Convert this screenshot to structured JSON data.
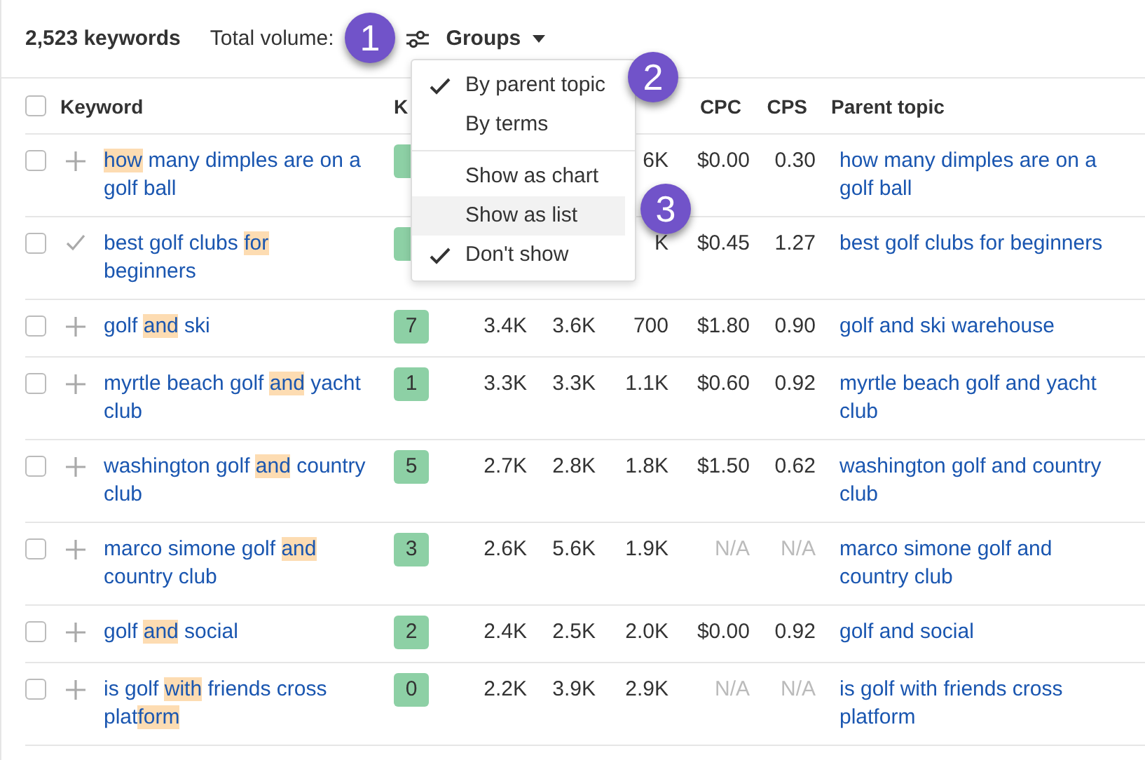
{
  "toolbar": {
    "keyword_count": "2,523 keywords",
    "total_volume_label": "Total volume:",
    "groups_label": "Groups"
  },
  "columns": {
    "select_all_checked": false,
    "keyword": "Keyword",
    "kd": "K",
    "cpc": "CPC",
    "cps": "CPS",
    "parent_topic": "Parent topic"
  },
  "rows": [
    {
      "checked": false,
      "added": false,
      "keyword": [
        {
          "text": "how",
          "highlight": true
        },
        {
          "text": " many dimples are on a golf ball",
          "highlight": false
        }
      ],
      "column_5": "6K",
      "cpc": "$0.00",
      "cps": "0.30",
      "unavailable": false,
      "parent_topic": "how many dimples are on a golf ball"
    },
    {
      "checked": false,
      "added": true,
      "keyword": [
        {
          "text": "best golf clubs ",
          "highlight": false
        },
        {
          "text": "for",
          "highlight": true
        },
        {
          "text": " beginners",
          "highlight": false
        }
      ],
      "column_5": "K",
      "cpc": "$0.45",
      "cps": "1.27",
      "unavailable": false,
      "parent_topic": "best golf clubs for beginners"
    },
    {
      "checked": false,
      "added": false,
      "keyword": [
        {
          "text": "golf ",
          "highlight": false
        },
        {
          "text": "and",
          "highlight": true
        },
        {
          "text": " ski",
          "highlight": false
        }
      ],
      "kd": "7",
      "column_3": "3.4K",
      "column_4": "3.6K",
      "column_5": "700",
      "cpc": "$1.80",
      "cps": "0.90",
      "unavailable": false,
      "parent_topic": "golf and ski warehouse"
    },
    {
      "checked": false,
      "added": false,
      "keyword": [
        {
          "text": "myrtle beach golf ",
          "highlight": false
        },
        {
          "text": "and",
          "highlight": true
        },
        {
          "text": " yacht club",
          "highlight": false
        }
      ],
      "kd": "1",
      "column_3": "3.3K",
      "column_4": "3.3K",
      "column_5": "1.1K",
      "cpc": "$0.60",
      "cps": "0.92",
      "unavailable": false,
      "parent_topic": "myrtle beach golf and yacht club"
    },
    {
      "checked": false,
      "added": false,
      "keyword": [
        {
          "text": "washington golf ",
          "highlight": false
        },
        {
          "text": "and",
          "highlight": true
        },
        {
          "text": " country club",
          "highlight": false
        }
      ],
      "kd": "5",
      "column_3": "2.7K",
      "column_4": "2.8K",
      "column_5": "1.8K",
      "cpc": "$1.50",
      "cps": "0.62",
      "unavailable": false,
      "parent_topic": "washington golf and country club"
    },
    {
      "checked": false,
      "added": false,
      "keyword": [
        {
          "text": "marco simone golf ",
          "highlight": false
        },
        {
          "text": "and",
          "highlight": true
        },
        {
          "text": " country club",
          "highlight": false
        }
      ],
      "kd": "3",
      "column_3": "2.6K",
      "column_4": "5.6K",
      "column_5": "1.9K",
      "cpc": "N/A",
      "cps": "N/A",
      "unavailable": true,
      "parent_topic": "marco simone golf and country club"
    },
    {
      "checked": false,
      "added": false,
      "keyword": [
        {
          "text": "golf ",
          "highlight": false
        },
        {
          "text": "and",
          "highlight": true
        },
        {
          "text": " social",
          "highlight": false
        }
      ],
      "kd": "2",
      "column_3": "2.4K",
      "column_4": "2.5K",
      "column_5": "2.0K",
      "cpc": "$0.00",
      "cps": "0.92",
      "unavailable": false,
      "parent_topic": "golf and social"
    },
    {
      "checked": false,
      "added": false,
      "keyword": [
        {
          "text": "is golf ",
          "highlight": false
        },
        {
          "text": "with",
          "highlight": true
        },
        {
          "text": " friends cross plat",
          "highlight": false
        },
        {
          "text": "form",
          "highlight": true
        }
      ],
      "kd": "0",
      "column_3": "2.2K",
      "column_4": "3.9K",
      "column_5": "2.9K",
      "cpc": "N/A",
      "cps": "N/A",
      "unavailable": true,
      "parent_topic": "is golf with friends cross platform"
    }
  ],
  "menu": {
    "items": [
      {
        "label": "By parent topic",
        "checked": true,
        "highlighted": false
      },
      {
        "label": "By terms",
        "checked": false,
        "highlighted": false
      },
      {
        "kind": "divider"
      },
      {
        "label": "Show as chart",
        "checked": false,
        "highlighted": false
      },
      {
        "label": "Show as list",
        "checked": false,
        "highlighted": true
      },
      {
        "label": "Don't show",
        "checked": true,
        "highlighted": false
      }
    ]
  },
  "callouts": [
    "1",
    "2",
    "3"
  ]
}
